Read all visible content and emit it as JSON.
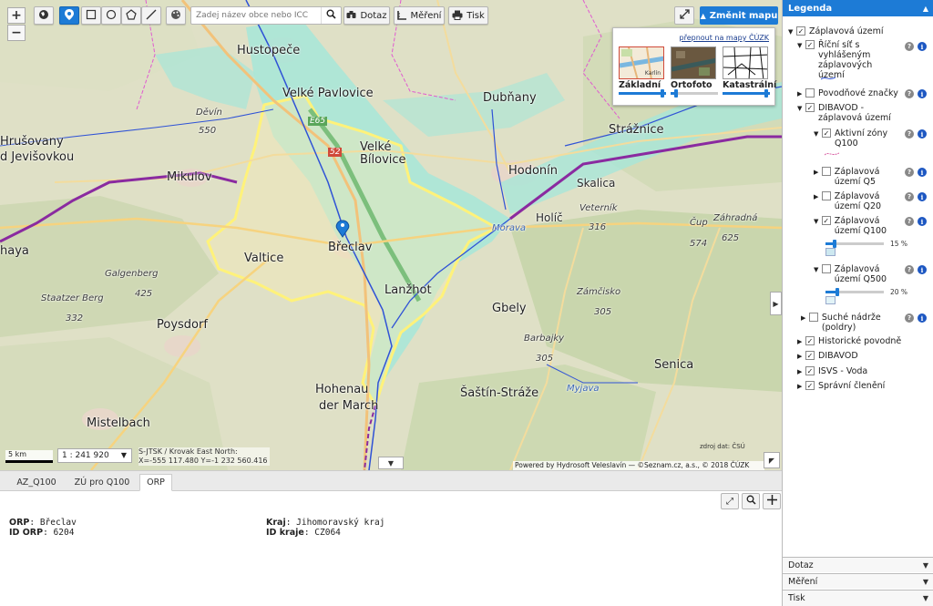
{
  "toolbar": {
    "search_placeholder": "Zadej název obce nebo ICC",
    "query_label": "Dotaz",
    "measure_label": "Měření",
    "print_label": "Tisk",
    "change_map_label": "Změnit mapu",
    "zoom_in": "+",
    "zoom_out": "−"
  },
  "basemaps": {
    "switch_link": "přepnout na mapy ČÚZK",
    "items": [
      {
        "label": "Základní",
        "thumb_text": "Karlín",
        "opacity": 1.0
      },
      {
        "label": "Ortofoto",
        "opacity": 0.1
      },
      {
        "label": "Katastrální",
        "opacity": 1.0
      }
    ]
  },
  "map": {
    "places": {
      "hustopece": "Hustopeče",
      "velke_pavlovice": "Velké Pavlovice",
      "dubnany": "Dubňany",
      "strasnice": "Strážnice",
      "devin": "Děvín",
      "devin_alt": "550",
      "hrusovany": "Hrušovany",
      "d_jevisovkou": "d Jevišovkou",
      "mikulov": "Mikulov",
      "velke_bilovice": "Velké Bílovice",
      "hodonin": "Hodonín",
      "skalica": "Skalica",
      "holic": "Holíč",
      "veternik": "Veterník",
      "veternik_alt": "316",
      "cup": "Čup",
      "cup_alt": "574",
      "zahradna": "Záhradná",
      "zahradna_alt": "625",
      "valtice": "Valtice",
      "breclav": "Břeclav",
      "haya": "haya",
      "galgenberg": "Galgenberg",
      "galgenberg_alt": "425",
      "staatzer_berg": "Staatzer Berg",
      "staatzer_alt": "332",
      "poysdorf": "Poysdorf",
      "lanzhot": "Lanžhot",
      "gbely": "Gbely",
      "zamcisko": "Zámčisko",
      "zamcisko_alt": "305",
      "barbajky": "Barbajky",
      "barbajky_alt": "305",
      "senica": "Senica",
      "hohenau": "Hohenau",
      "an_der_march": "der March",
      "sastin": "Šaštín-Stráže",
      "myjava": "Myjava",
      "mistelbach": "Mistelbach",
      "road_e65": "E65",
      "road_52": "52",
      "morava": "Morava"
    },
    "scale_bar": "5 km",
    "scale_value": "1 : 241 920",
    "crs_line1": "S-JTSK / Krovak East North:",
    "crs_line2": "X=-555 117.480 Y=-1 232 560.416",
    "attribution": "Powered by Hydrosoft Veleslavín — ©Seznam.cz, a.s., © 2018 ČÚZK",
    "source_note": "zdroj dat: ČSÚ"
  },
  "bottom": {
    "tabs": [
      "AZ_Q100",
      "ZÚ pro Q100",
      "ORP"
    ],
    "active_tab": "ORP",
    "fields": {
      "orp_label": "ORP",
      "orp_value": "Břeclav",
      "id_orp_label": "ID ORP",
      "id_orp_value": "6204",
      "kraj_label": "Kraj",
      "kraj_value": "Jihomoravský kraj",
      "id_kraje_label": "ID kraje",
      "id_kraje_value": "CZ064"
    }
  },
  "legend": {
    "title": "Legenda",
    "items": {
      "zaplavova": "Záplavová území",
      "ricni_sit": "Říční síť s vyhlášeným záplavových území",
      "povodnove_znacky": "Povodňové značky",
      "dibavod_zaplavova": "DIBAVOD - záplavová území",
      "aktivni_zony": "Aktivní zóny Q100",
      "zu_q5": "Záplavová území Q5",
      "zu_q20": "Záplavová území Q20",
      "zu_q100": "Záplavová území Q100",
      "zu_q100_opacity": "15 %",
      "zu_q500": "Záplavová území Q500",
      "zu_q500_opacity": "20 %",
      "suche_nadrze": "Suché nádrže (poldry)",
      "historicke": "Historické povodně",
      "dibavod": "DIBAVOD",
      "isvs": "ISVS - Voda",
      "spravni": "Správní členění"
    },
    "accordions": [
      "Dotaz",
      "Měření",
      "Tisk"
    ]
  },
  "colors": {
    "accent": "#1d7bd6",
    "flood_fill": "#9fe3d6",
    "orp_boundary": "#fff27a",
    "state_border": "#8a2aa0"
  }
}
